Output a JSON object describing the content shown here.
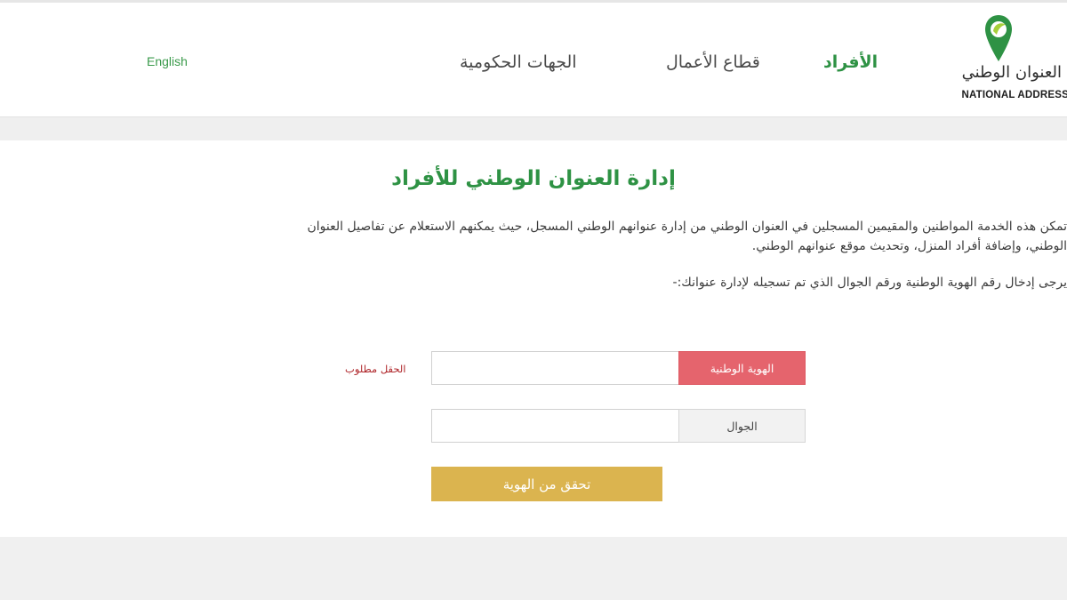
{
  "header": {
    "logo": {
      "arabic_text": "العنوان الوطني",
      "english_text": "NATIONAL ADDRESS",
      "icon": "location-pin-icon",
      "pin_color": "#2e9244",
      "pin_accent": "#a6cf3a"
    },
    "nav": {
      "individuals": "الأفراد",
      "business": "قطاع الأعمال",
      "government": "الجهات الحكومية"
    },
    "language_link": "English"
  },
  "main": {
    "title": "إدارة العنوان الوطني للأفراد",
    "description_line1": "تمكن هذه الخدمة المواطنين والمقيمين المسجلين في العنوان الوطني من إدارة عنوانهم الوطني المسجل، حيث يمكنهم الاستعلام عن تفاصيل العنوان",
    "description_line2": "الوطني، وإضافة أفراد المنزل، وتحديث موقع عنوانهم الوطني.",
    "instruction": "يرجى إدخال رقم الهوية الوطنية ورقم الجوال الذي تم تسجيله لإدارة عنوانك:-",
    "form": {
      "national_id_label": "الهوية الوطنية",
      "national_id_value": "",
      "required_message": "الحقل مطلوب",
      "mobile_label": "الجوال",
      "mobile_value": "",
      "submit_label": "تحقق من الهوية"
    }
  },
  "colors": {
    "brand_green": "#2e9244",
    "error_red": "#e5646d",
    "button_gold": "#dbb44f"
  }
}
